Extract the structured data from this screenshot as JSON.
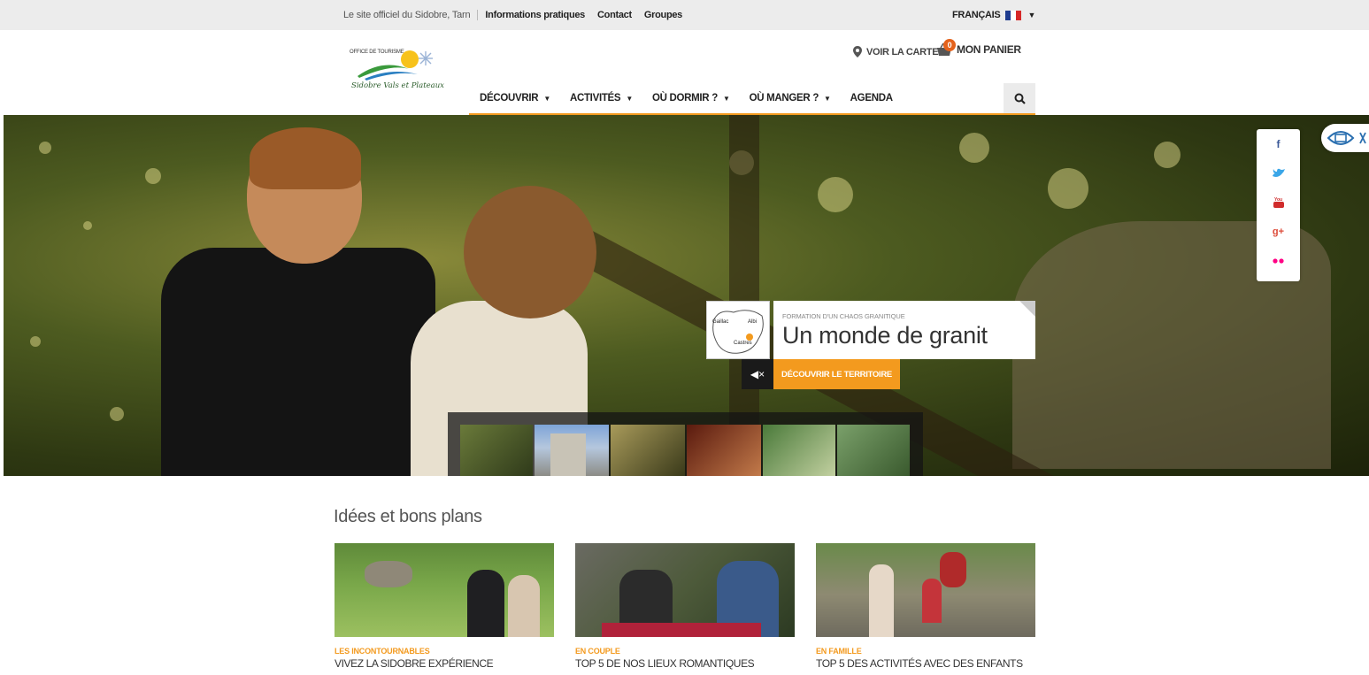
{
  "topbar": {
    "tagline": "Le site officiel du Sidobre, Tarn",
    "links": [
      "Informations pratiques",
      "Contact",
      "Groupes"
    ],
    "language": "FRANÇAIS"
  },
  "logo": {
    "small_text": "OFFICE DE TOURISME",
    "script_text": "Sidobre Vals et Plateaux"
  },
  "header": {
    "map_label": "VOIR LA CARTE",
    "cart_label": "MON PANIER",
    "cart_count": "0"
  },
  "nav": {
    "items": [
      {
        "label": "DÉCOUVRIR",
        "dropdown": true
      },
      {
        "label": "ACTIVITÉS",
        "dropdown": true
      },
      {
        "label": "OÙ DORMIR ?",
        "dropdown": true
      },
      {
        "label": "OÙ MANGER ?",
        "dropdown": true
      },
      {
        "label": "AGENDA",
        "dropdown": false
      }
    ]
  },
  "hero": {
    "kicker": "FORMATION D'UN CHAOS GRANITIQUE",
    "title": "Un monde de granit",
    "cta_label": "DÉCOUVRIR LE TERRITOIRE",
    "map_labels": [
      "Gaillac",
      "Albi",
      "Castres"
    ]
  },
  "social": [
    "f",
    "twitter",
    "You Tube",
    "g+",
    "flickr"
  ],
  "ideas": {
    "section_title": "Idées et bons plans",
    "items": [
      {
        "category": "LES INCONTOURNABLES",
        "title": "VIVEZ LA SIDOBRE EXPÉRIENCE"
      },
      {
        "category": "EN COUPLE",
        "title": "TOP 5 DE NOS LIEUX ROMANTIQUES"
      },
      {
        "category": "EN FAMILLE",
        "title": "TOP 5 DES ACTIVITÉS AVEC DES ENFANTS"
      }
    ]
  },
  "colors": {
    "accent": "#f39a1e",
    "badge": "#e4621b"
  }
}
